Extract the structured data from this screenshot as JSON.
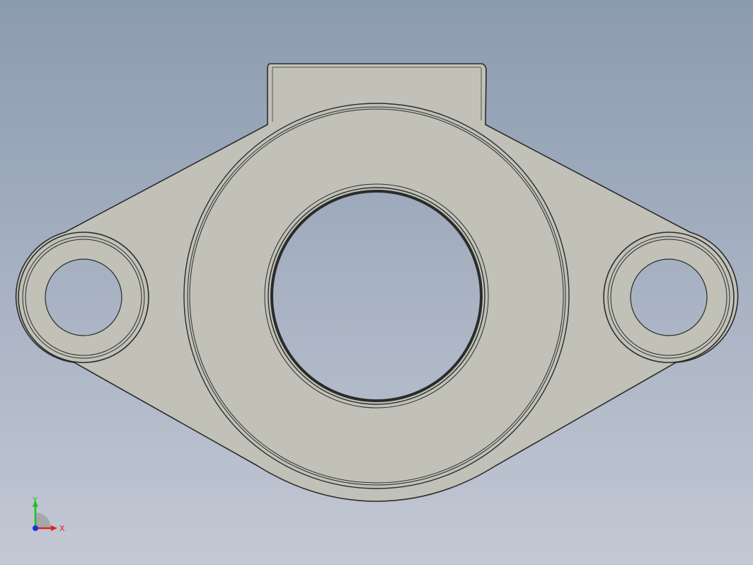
{
  "viewport": {
    "background_top": "#8b9bb0",
    "background_bottom": "#c3c8d4",
    "part_fill": "#c1c1b8",
    "edge_color": "#2b2b2b"
  },
  "part": {
    "name": "flange-bracket",
    "holes": [
      "left-bolt-hole",
      "center-bore",
      "right-bolt-hole"
    ]
  },
  "triad": {
    "x_label": "X",
    "y_label": "Y",
    "x_color": "#e02020",
    "y_color": "#20c020",
    "z_color": "#2030e0"
  }
}
